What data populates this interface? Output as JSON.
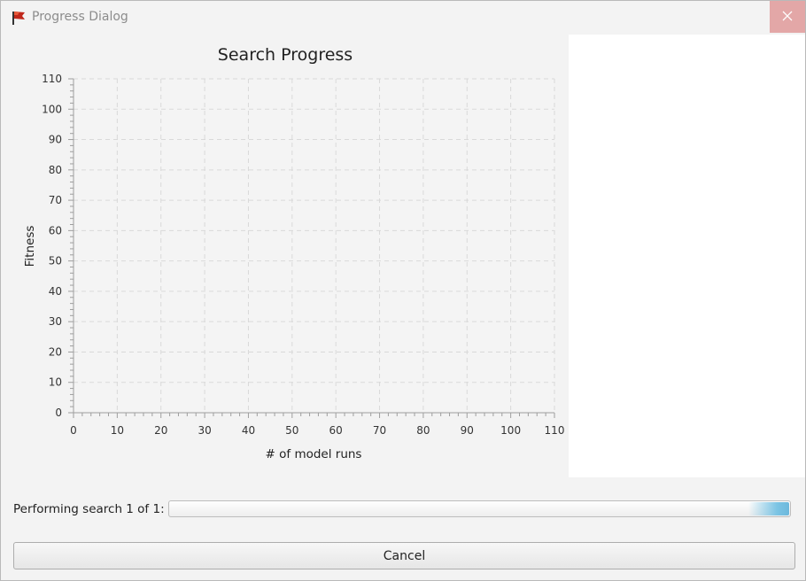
{
  "window": {
    "title": "Progress Dialog",
    "icon": "app-flag-icon",
    "close_icon": "close-icon"
  },
  "chart_data": {
    "type": "line",
    "title": "Search Progress",
    "xlabel": "# of model runs",
    "ylabel": "Fitness",
    "xlim": [
      0,
      110
    ],
    "ylim": [
      0,
      110
    ],
    "xticks": [
      0,
      10,
      20,
      30,
      40,
      50,
      60,
      70,
      80,
      90,
      100,
      110
    ],
    "yticks": [
      0,
      10,
      20,
      30,
      40,
      50,
      60,
      70,
      80,
      90,
      100,
      110
    ],
    "grid": true,
    "series": []
  },
  "status": {
    "label": "Performing search 1 of 1:",
    "progress_mode": "indeterminate"
  },
  "buttons": {
    "cancel_label": "Cancel"
  }
}
